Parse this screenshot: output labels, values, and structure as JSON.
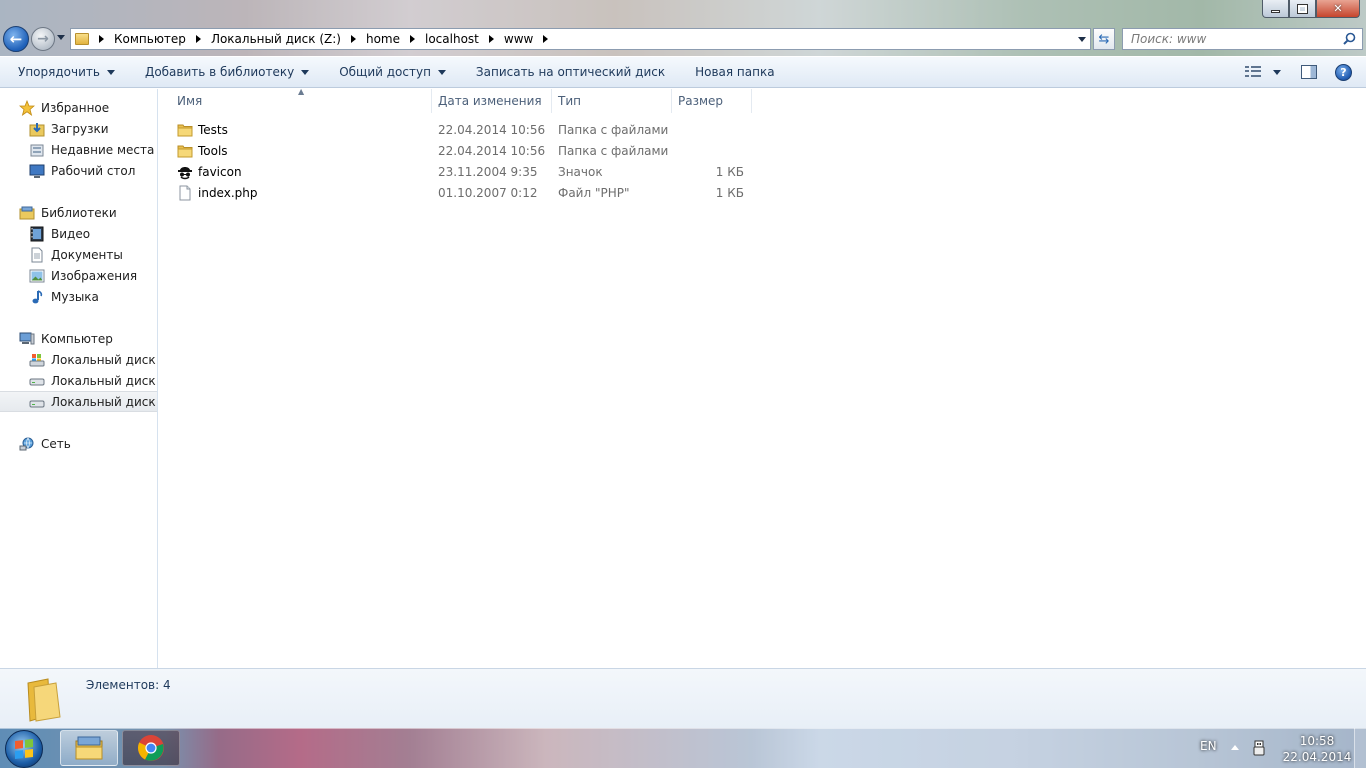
{
  "window": {
    "address": {
      "crumbs": [
        "Компьютер",
        "Локальный диск (Z:)",
        "home",
        "localhost",
        "www"
      ]
    },
    "search": {
      "placeholder": "Поиск: www"
    }
  },
  "toolbar": {
    "organize": "Упорядочить",
    "add_to_library": "Добавить в библиотеку",
    "share": "Общий доступ",
    "burn": "Записать на оптический диск",
    "new_folder": "Новая папка"
  },
  "navpane": {
    "favorites": {
      "label": "Избранное",
      "items": [
        {
          "label": "Загрузки",
          "icon": "downloads-icon"
        },
        {
          "label": "Недавние места",
          "icon": "recent-places-icon"
        },
        {
          "label": "Рабочий стол",
          "icon": "desktop-icon"
        }
      ]
    },
    "libraries": {
      "label": "Библиотеки",
      "items": [
        {
          "label": "Видео",
          "icon": "video-icon"
        },
        {
          "label": "Документы",
          "icon": "documents-icon"
        },
        {
          "label": "Изображения",
          "icon": "pictures-icon"
        },
        {
          "label": "Музыка",
          "icon": "music-icon"
        }
      ]
    },
    "computer": {
      "label": "Компьютер",
      "items": [
        {
          "label": "Локальный диск (C",
          "icon": "system-drive-icon"
        },
        {
          "label": "Локальный диск (D",
          "icon": "drive-icon"
        },
        {
          "label": "Локальный диск (Z",
          "icon": "drive-icon",
          "selected": true
        }
      ]
    },
    "network": {
      "label": "Сеть"
    }
  },
  "filelist": {
    "columns": {
      "name": "Имя",
      "modified": "Дата изменения",
      "type": "Тип",
      "size": "Размер"
    },
    "rows": [
      {
        "name": "Tests",
        "modified": "22.04.2014 10:56",
        "type": "Папка с файлами",
        "size": "",
        "icon": "folder-icon"
      },
      {
        "name": "Tools",
        "modified": "22.04.2014 10:56",
        "type": "Папка с файлами",
        "size": "",
        "icon": "folder-icon"
      },
      {
        "name": "favicon",
        "modified": "23.11.2004 9:35",
        "type": "Значок",
        "size": "1 КБ",
        "icon": "favicon-icon"
      },
      {
        "name": "index.php",
        "modified": "01.10.2007 0:12",
        "type": "Файл \"PHP\"",
        "size": "1 КБ",
        "icon": "file-icon"
      }
    ]
  },
  "details": {
    "count": "Элементов: 4"
  },
  "taskbar": {
    "lang": "EN",
    "time": "10:58",
    "date": "22.04.2014"
  }
}
